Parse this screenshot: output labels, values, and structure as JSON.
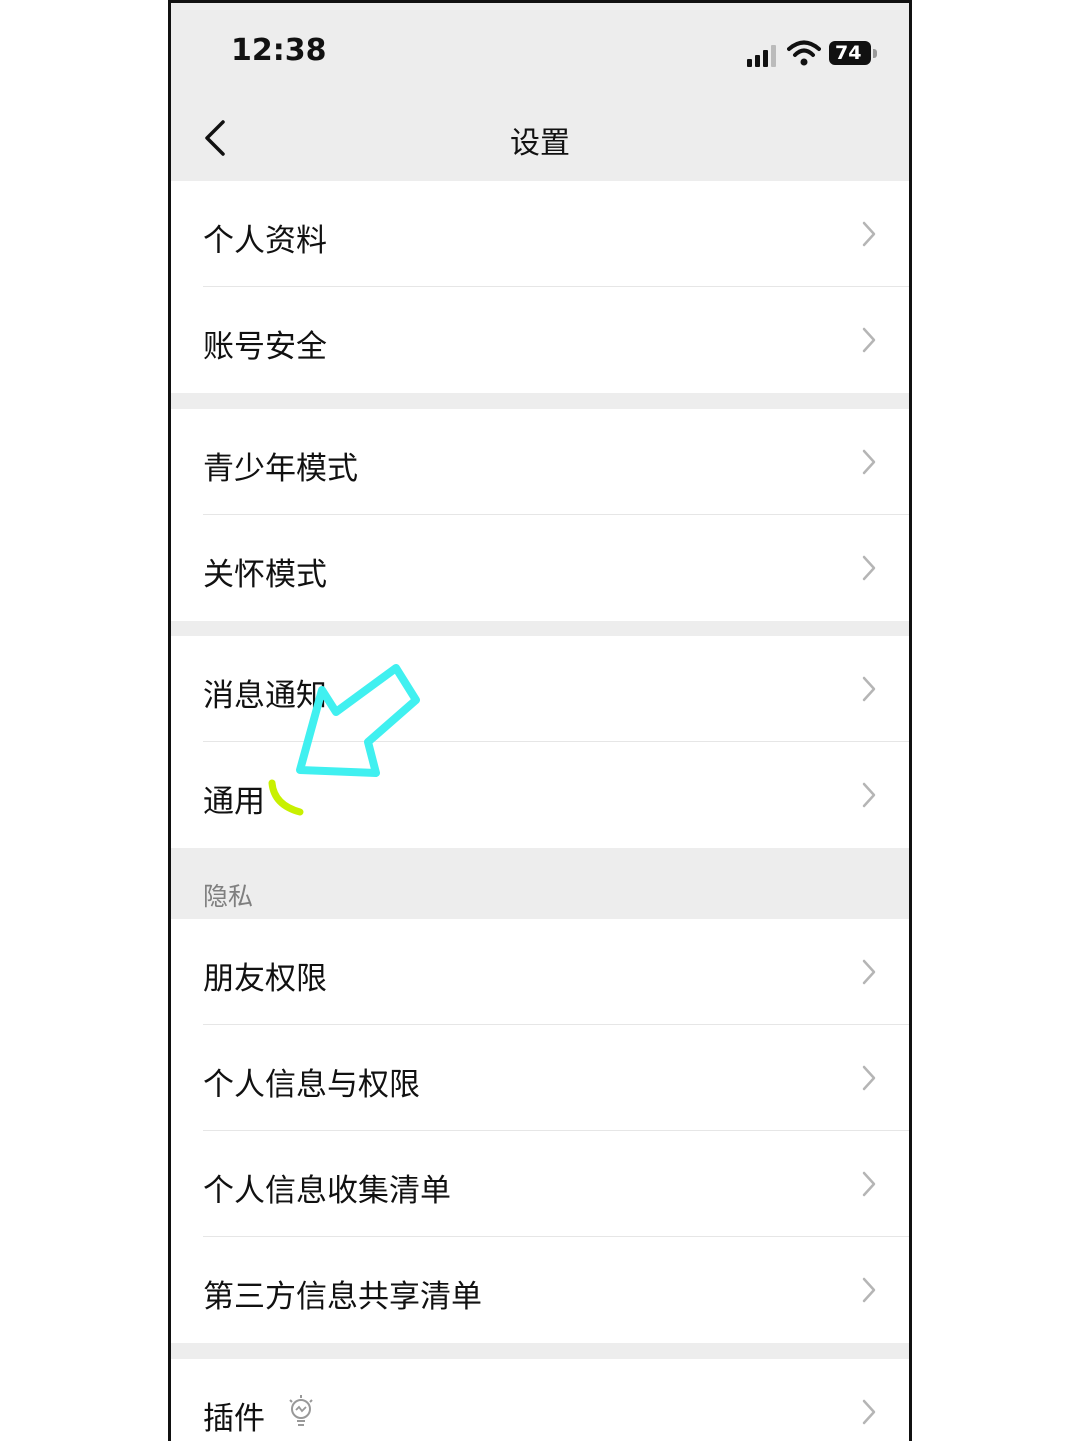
{
  "status_bar": {
    "time": "12:38",
    "battery": "74"
  },
  "nav": {
    "title": "设置",
    "back_icon": "chevron-left-icon"
  },
  "groups": [
    {
      "items": [
        {
          "label": "个人资料"
        },
        {
          "label": "账号安全"
        }
      ]
    },
    {
      "items": [
        {
          "label": "青少年模式"
        },
        {
          "label": "关怀模式"
        }
      ]
    },
    {
      "items": [
        {
          "label": "消息通知"
        },
        {
          "label": "通用"
        }
      ]
    },
    {
      "title": "隐私",
      "items": [
        {
          "label": "朋友权限"
        },
        {
          "label": "个人信息与权限"
        },
        {
          "label": "个人信息收集清单"
        },
        {
          "label": "第三方信息共享清单"
        }
      ]
    },
    {
      "items": [
        {
          "label": "插件",
          "icon": "plugin-bulb-icon"
        }
      ]
    }
  ],
  "colors": {
    "background": "#ededed",
    "arrow_annotation": "#40f0f0",
    "mark_annotation": "#c8f000"
  }
}
